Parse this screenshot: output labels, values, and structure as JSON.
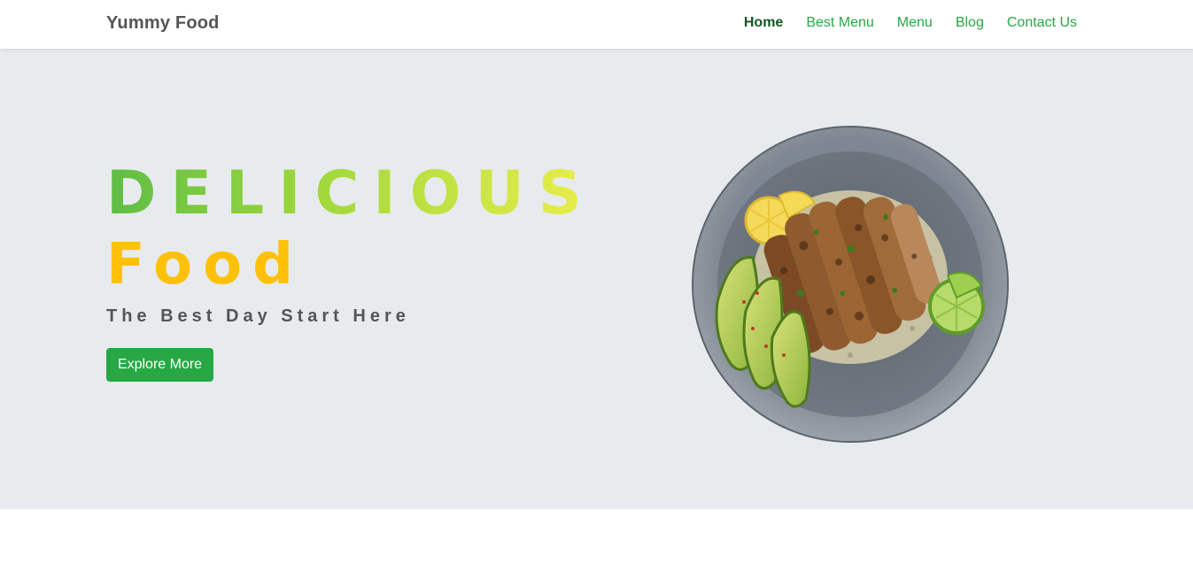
{
  "navbar": {
    "brand": "Yummy Food",
    "links": [
      {
        "label": "Home",
        "active": true
      },
      {
        "label": "Best Menu",
        "active": false
      },
      {
        "label": "Menu",
        "active": false
      },
      {
        "label": "Blog",
        "active": false
      },
      {
        "label": "Contact Us",
        "active": false
      }
    ]
  },
  "hero": {
    "headline": "DELICIOUS",
    "subheadline": "Food",
    "tagline": "The Best Day Start Here",
    "cta_label": "Explore More",
    "image_icon": "grilled-chicken-plate-image"
  },
  "colors": {
    "accent": "#28a745",
    "active_link": "#155724",
    "highlight": "#ffc107",
    "headline_gradient": [
      "#5ebd45",
      "#eaee4a"
    ],
    "hero_background": "#e8ebee",
    "text_muted": "#555555"
  }
}
